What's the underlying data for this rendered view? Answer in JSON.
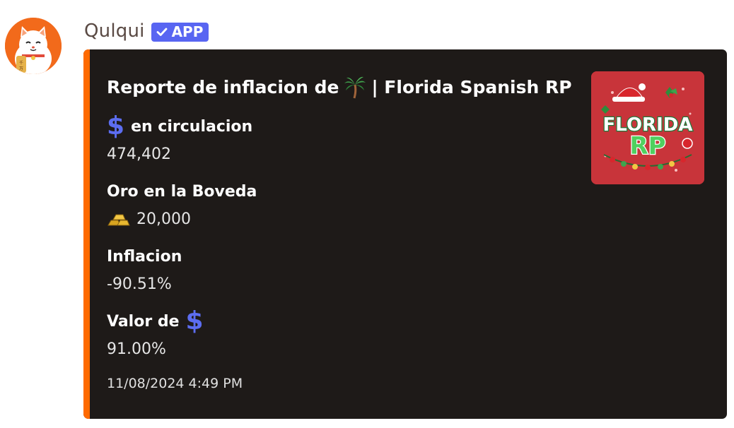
{
  "message": {
    "author": "Qulqui",
    "badge_label": "APP",
    "avatar_icon": "lucky-cat-icon",
    "badge_icon": "checkmark-icon"
  },
  "embed": {
    "accent_color": "#ff6a00",
    "title_prefix": "Reporte de inflacion de",
    "title_emoji": "palm-tree-icon",
    "title_suffix": "| Florida Spanish RP",
    "thumbnail_text_top": "FLORIDA",
    "thumbnail_text_bottom": "RP",
    "fields": [
      {
        "name": "en circulacion",
        "name_icon": "dollar-icon",
        "value": "474,402"
      },
      {
        "name": "Oro en la Boveda",
        "value": "20,000",
        "value_icon": "gold-bars-icon"
      },
      {
        "name": "Inflacion",
        "value": "-90.51%"
      },
      {
        "name": "Valor de",
        "name_icon": "dollar-icon",
        "value": "91.00%"
      }
    ],
    "timestamp": "11/08/2024 4:49 PM"
  },
  "colors": {
    "embed_background": "#1e1a18",
    "badge": "#5865f2",
    "dollar_icon": "#5c6df0"
  }
}
